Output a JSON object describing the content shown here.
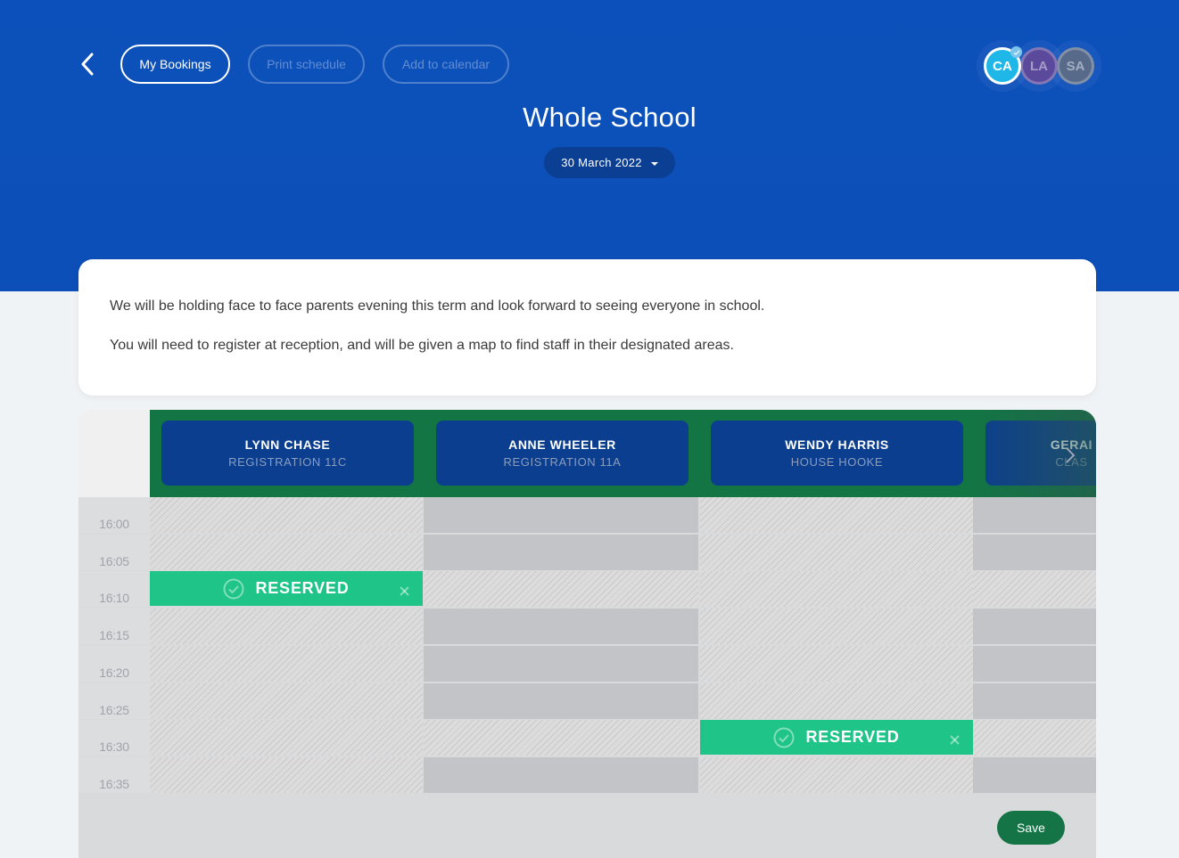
{
  "toolbar": {
    "back_icon": "chevron-left-icon",
    "my_bookings_label": "My Bookings",
    "print_schedule_label": "Print schedule",
    "add_to_calendar_label": "Add to calendar"
  },
  "users": [
    {
      "initials": "CA",
      "selected": true,
      "color": "#1FB7E8"
    },
    {
      "initials": "LA",
      "selected": false,
      "color": "#5B4A9C"
    },
    {
      "initials": "SA",
      "selected": false,
      "color": "#576A8A"
    }
  ],
  "header": {
    "title": "Whole School",
    "date": "30 March 2022"
  },
  "info": {
    "paragraphs": [
      "We will be holding face to face parents evening this term and look forward to seeing everyone in school.",
      "You will need to register at reception, and will be given a map to find staff in their designated areas."
    ]
  },
  "schedule": {
    "staff": [
      {
        "name": "LYNN CHASE",
        "subtitle": "REGISTRATION 11C"
      },
      {
        "name": "ANNE WHEELER",
        "subtitle": "REGISTRATION 11A"
      },
      {
        "name": "WENDY HARRIS",
        "subtitle": "HOUSE HOOKE"
      },
      {
        "name": "GERAI",
        "subtitle": "CLAS"
      }
    ],
    "times": [
      "16:00",
      "16:05",
      "16:10",
      "16:15",
      "16:20",
      "16:25",
      "16:30",
      "16:35"
    ],
    "slots": [
      [
        "unavailable",
        "unavailable",
        "reserved",
        "unavailable",
        "unavailable",
        "unavailable",
        "unavailable",
        "unavailable"
      ],
      [
        "available",
        "available",
        "unavailable",
        "available",
        "available",
        "available",
        "unavailable",
        "available"
      ],
      [
        "unavailable",
        "unavailable",
        "unavailable",
        "unavailable",
        "unavailable",
        "unavailable",
        "reserved",
        "unavailable"
      ],
      [
        "available",
        "available",
        "unavailable",
        "available",
        "available",
        "available",
        "unavailable",
        "available"
      ]
    ],
    "reserved_label": "RESERVED",
    "save_label": "Save"
  },
  "colors": {
    "header_blue": "#0C50BB",
    "staff_band_green": "#137544",
    "staff_card_blue": "#0B3E8E",
    "reserved_green": "#1EC488",
    "save_green": "#147446"
  }
}
